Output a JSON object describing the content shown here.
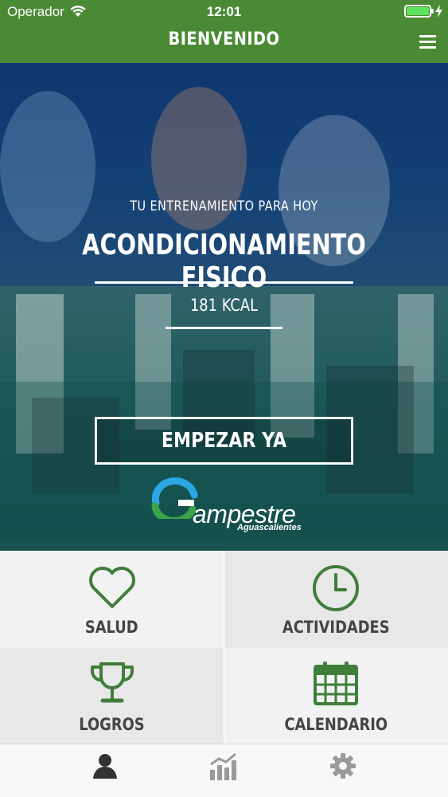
{
  "status_bar": {
    "carrier": "Operador",
    "time": "12:01"
  },
  "header": {
    "title": "BIENVENIDO",
    "menu_icon": "hamburger-menu-icon"
  },
  "hero": {
    "subtitle": "TU ENTRENAMIENTO PARA HOY",
    "workout": "ACONDICIONAMIENTO FISICO",
    "calories": "181 KCAL",
    "start_button": "EMPEZAR YA",
    "logo": {
      "word": "ampestre",
      "sub": "Aguascalientes"
    }
  },
  "tiles": [
    {
      "label": "SALUD",
      "icon": "heart-icon"
    },
    {
      "label": "ACTIVIDADES",
      "icon": "clock-icon"
    },
    {
      "label": "LOGROS",
      "icon": "trophy-icon"
    },
    {
      "label": "CALENDARIO",
      "icon": "calendar-icon"
    }
  ],
  "tabbar": [
    {
      "icon": "profile-icon",
      "active": true
    },
    {
      "icon": "stats-icon",
      "active": false
    },
    {
      "icon": "settings-gear-icon",
      "active": false
    }
  ],
  "colors": {
    "brand_green": "#4b8a35",
    "icon_green": "#3f7e3a",
    "tile_light": "#f2f2f2",
    "tile_dark": "#e8e8e8"
  }
}
